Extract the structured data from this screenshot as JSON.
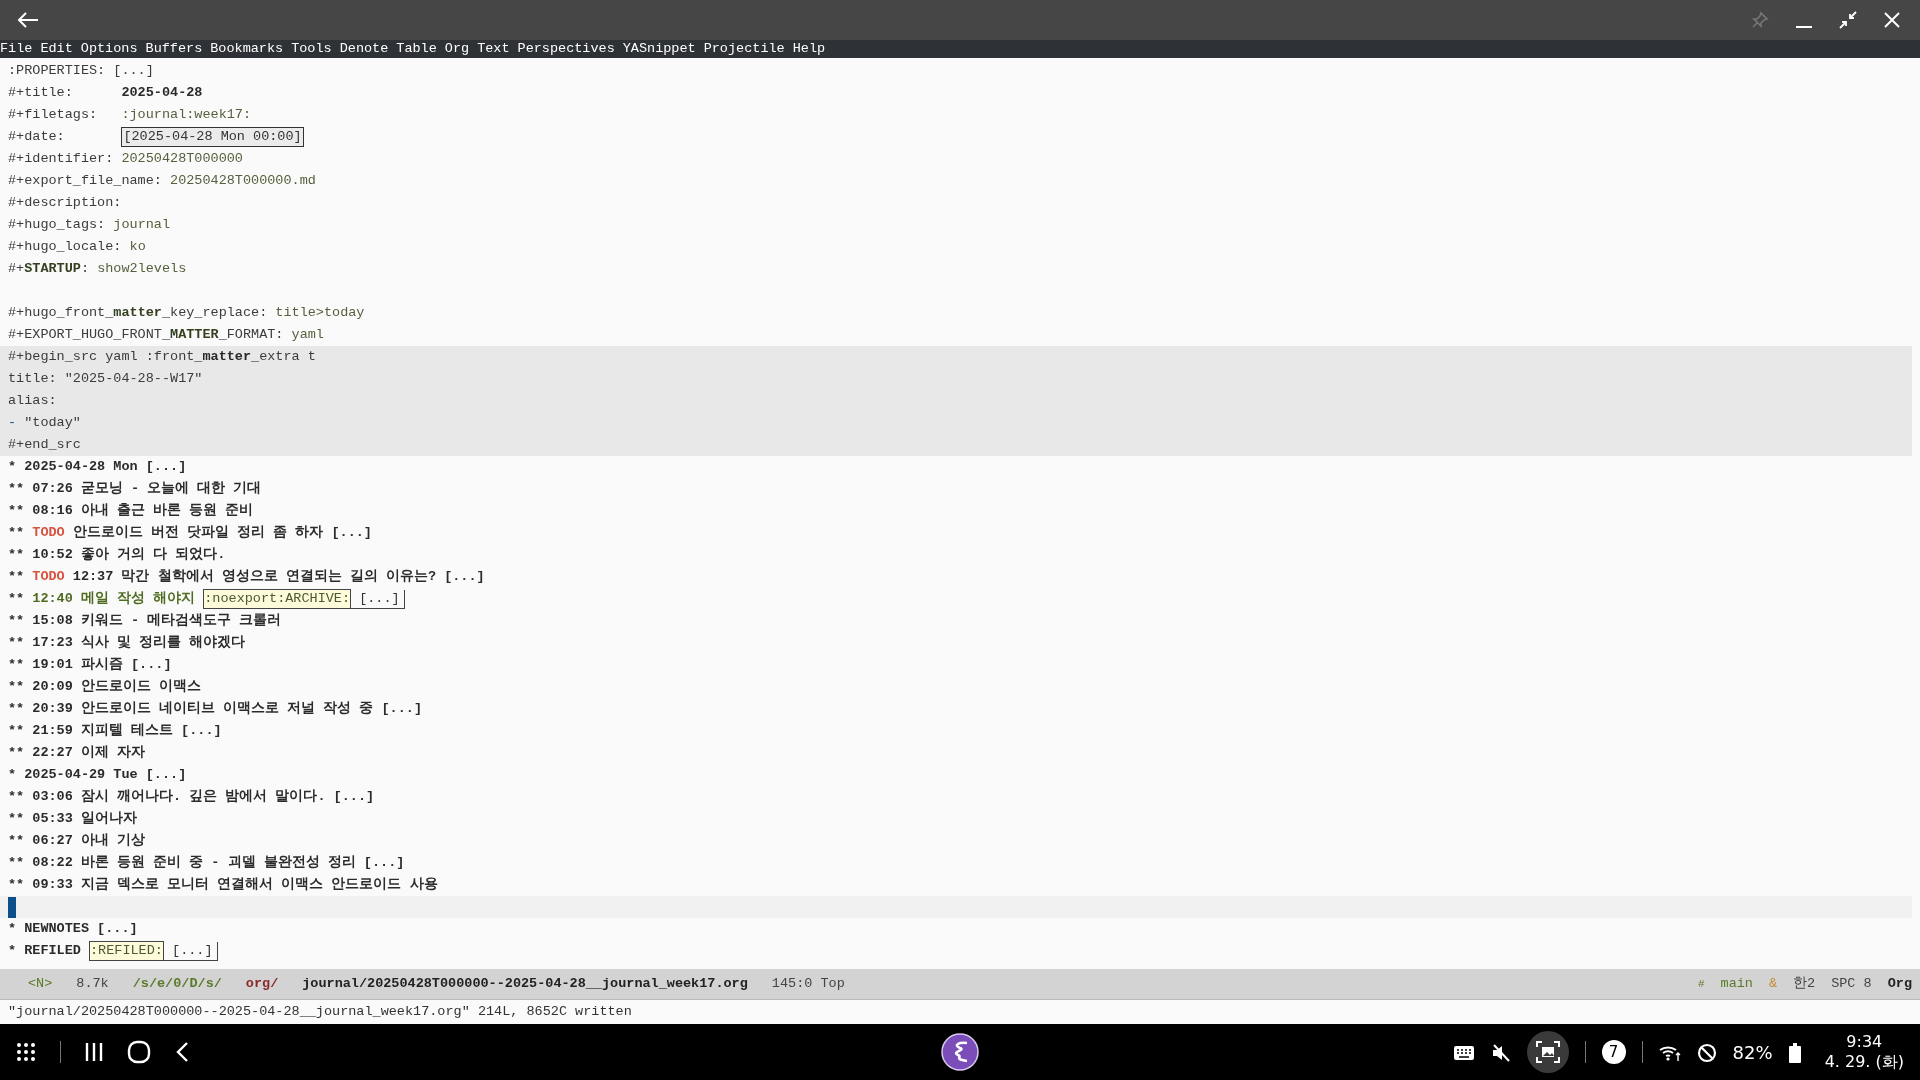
{
  "menu": [
    "File",
    "Edit",
    "Options",
    "Buffers",
    "Bookmarks",
    "Tools",
    "Denote",
    "Table",
    "Org",
    "Text",
    "Perspectives",
    "YASnippet",
    "Projectile",
    "Help"
  ],
  "lines": [
    {
      "kind": "text",
      "segments": [
        {
          "text": ":PROPERTIES: [...]",
          "kind": "meta"
        }
      ]
    },
    {
      "kind": "text",
      "segments": [
        {
          "text": "#+title:      ",
          "kind": "meta"
        },
        {
          "text": "2025-04-28",
          "kind": "strong"
        }
      ]
    },
    {
      "kind": "text",
      "segments": [
        {
          "text": "#+filetags:   ",
          "kind": "meta"
        },
        {
          "text": ":journal:week17:",
          "kind": "value"
        }
      ]
    },
    {
      "kind": "text",
      "segments": [
        {
          "text": "#+date:       ",
          "kind": "meta"
        },
        {
          "text": "[2025-04-28 Mon 00:00]",
          "kind": "date"
        }
      ]
    },
    {
      "kind": "text",
      "segments": [
        {
          "text": "#+identifier: ",
          "kind": "meta"
        },
        {
          "text": "20250428T000000",
          "kind": "value"
        }
      ]
    },
    {
      "kind": "text",
      "segments": [
        {
          "text": "#+export_file_name: ",
          "kind": "meta"
        },
        {
          "text": "20250428T000000.md",
          "kind": "value"
        }
      ]
    },
    {
      "kind": "text",
      "segments": [
        {
          "text": "#+description:",
          "kind": "meta"
        }
      ]
    },
    {
      "kind": "text",
      "segments": [
        {
          "text": "#+hugo_tags: ",
          "kind": "meta"
        },
        {
          "text": "journal",
          "kind": "value"
        }
      ]
    },
    {
      "kind": "text",
      "segments": [
        {
          "text": "#+hugo_locale: ",
          "kind": "meta"
        },
        {
          "text": "ko",
          "kind": "value"
        }
      ]
    },
    {
      "kind": "text",
      "segments": [
        {
          "text": "#+",
          "kind": "meta"
        },
        {
          "text": "STARTUP",
          "kind": "strongvalue"
        },
        {
          "text": ": ",
          "kind": "meta"
        },
        {
          "text": "show2levels",
          "kind": "value"
        }
      ]
    },
    {
      "kind": "blank"
    },
    {
      "kind": "text",
      "segments": [
        {
          "text": "#+hugo_front_",
          "kind": "meta"
        },
        {
          "text": "matter",
          "kind": "strongvalue"
        },
        {
          "text": "_key_replace: ",
          "kind": "meta"
        },
        {
          "text": "title>today",
          "kind": "value"
        }
      ]
    },
    {
      "kind": "text",
      "segments": [
        {
          "text": "#+EXPORT_HUGO_FRONT_",
          "kind": "meta"
        },
        {
          "text": "MATTER",
          "kind": "strongvalue"
        },
        {
          "text": "_FORMAT: ",
          "kind": "meta"
        },
        {
          "text": "yaml",
          "kind": "value"
        }
      ]
    },
    {
      "kind": "src",
      "segments": [
        {
          "text": "#+begin_src yaml :front_",
          "kind": "meta"
        },
        {
          "text": "matter",
          "kind": "strong"
        },
        {
          "text": "_extra t",
          "kind": "meta"
        }
      ]
    },
    {
      "kind": "src",
      "segments": [
        {
          "text": "title: \"2025-04-28--W17\"",
          "kind": "meta"
        }
      ]
    },
    {
      "kind": "src",
      "segments": [
        {
          "text": "alias:",
          "kind": "meta"
        }
      ]
    },
    {
      "kind": "src",
      "segments": [
        {
          "text": "- ",
          "kind": "blue"
        },
        {
          "text": "\"today\"",
          "kind": "meta"
        }
      ]
    },
    {
      "kind": "src",
      "segments": [
        {
          "text": "#+end_src",
          "kind": "meta"
        }
      ]
    },
    {
      "kind": "text",
      "segments": [
        {
          "text": "* 2025-04-28 Mon [...]",
          "kind": "heading"
        }
      ]
    },
    {
      "kind": "text",
      "segments": [
        {
          "text": "** 07:26 굳모닝 - 오늘에 대한 기대",
          "kind": "heading"
        }
      ]
    },
    {
      "kind": "text",
      "segments": [
        {
          "text": "** 08:16 아내 출근 바론 등원 준비",
          "kind": "heading"
        }
      ]
    },
    {
      "kind": "text",
      "segments": [
        {
          "text": "** ",
          "kind": "heading"
        },
        {
          "text": "TODO",
          "kind": "todo"
        },
        {
          "text": " 안드로이드 버전 닷파일 정리 좀 하자 [...]",
          "kind": "heading"
        }
      ]
    },
    {
      "kind": "text",
      "segments": [
        {
          "text": "** 10:52 좋아 거의 다 되었다.",
          "kind": "heading"
        }
      ]
    },
    {
      "kind": "text",
      "segments": [
        {
          "text": "** ",
          "kind": "heading"
        },
        {
          "text": "TODO",
          "kind": "todo"
        },
        {
          "text": " 12:37 막간 철학에서 영성으로 연결되는 길의 이유는? [...]",
          "kind": "heading"
        }
      ]
    },
    {
      "kind": "text",
      "segments": [
        {
          "text": "** ",
          "kind": "heading"
        },
        {
          "text": "12:40 메일 작성 해야지 ",
          "kind": "done"
        },
        {
          "text": ":noexport:ARCHIVE:",
          "kind": "tag"
        },
        {
          "text": " [...]",
          "kind": "fold"
        }
      ]
    },
    {
      "kind": "text",
      "segments": [
        {
          "text": "** 15:08 키워드 - 메타검색도구 크롤러",
          "kind": "heading"
        }
      ]
    },
    {
      "kind": "text",
      "segments": [
        {
          "text": "** 17:23 식사 및 정리를 해야겠다",
          "kind": "heading"
        }
      ]
    },
    {
      "kind": "text",
      "segments": [
        {
          "text": "** 19:01 파시즘 [...]",
          "kind": "heading"
        }
      ]
    },
    {
      "kind": "text",
      "segments": [
        {
          "text": "** 20:09 안드로이드 이맥스",
          "kind": "heading"
        }
      ]
    },
    {
      "kind": "text",
      "segments": [
        {
          "text": "** 20:39 안드로이드 네이티브 이맥스로 저널 작성 중 [...]",
          "kind": "heading"
        }
      ]
    },
    {
      "kind": "text",
      "segments": [
        {
          "text": "** 21:59 지피텔 테스트 [...]",
          "kind": "heading"
        }
      ]
    },
    {
      "kind": "text",
      "segments": [
        {
          "text": "** 22:27 이제 자자",
          "kind": "heading"
        }
      ]
    },
    {
      "kind": "text",
      "segments": [
        {
          "text": "* 2025-04-29 Tue [...]",
          "kind": "heading"
        }
      ]
    },
    {
      "kind": "text",
      "segments": [
        {
          "text": "** 03:06 잠시 깨어나다. 깊은 밤에서 말이다. [...]",
          "kind": "heading"
        }
      ]
    },
    {
      "kind": "text",
      "segments": [
        {
          "text": "** 05:33 일어나자",
          "kind": "heading"
        }
      ]
    },
    {
      "kind": "text",
      "segments": [
        {
          "text": "** 06:27 아내 기상",
          "kind": "heading"
        }
      ]
    },
    {
      "kind": "text",
      "segments": [
        {
          "text": "** 08:22 바론 등원 준비 중 - 괴델 불완전성 정리 [...]",
          "kind": "heading"
        }
      ]
    },
    {
      "kind": "text",
      "segments": [
        {
          "text": "** 09:33 지금 덱스로 모니터 연결해서 이맥스 안드로이드 사용",
          "kind": "heading"
        }
      ]
    },
    {
      "kind": "cursor"
    },
    {
      "kind": "text",
      "segments": [
        {
          "text": "* NEWNOTES [...]",
          "kind": "heading"
        }
      ]
    },
    {
      "kind": "text",
      "segments": [
        {
          "text": "* REFILED ",
          "kind": "heading"
        },
        {
          "text": ":REFILED:",
          "kind": "tag"
        },
        {
          "text": " [...]",
          "kind": "fold"
        }
      ]
    }
  ],
  "mode_line": {
    "left": [
      {
        "text": "<N>",
        "kind": "green"
      },
      {
        "text": "8.7k",
        "kind": "plain"
      },
      {
        "text": "/s/e/0/D/s/",
        "kind": "greenbold"
      },
      {
        "text": "org/",
        "kind": "redbold"
      },
      {
        "text": "journal/20250428T000000--2025-04-28__journal_week17.org",
        "kind": "bold"
      },
      {
        "text": "145:0 Top",
        "kind": "plain"
      }
    ],
    "right": [
      {
        "text": "#",
        "kind": "greensmall"
      },
      {
        "text": "main",
        "kind": "green"
      },
      {
        "text": "&",
        "kind": "orange"
      },
      {
        "text": "한2",
        "kind": "plain"
      },
      {
        "text": "SPC 8",
        "kind": "plain"
      },
      {
        "text": "Org",
        "kind": "bold"
      }
    ]
  },
  "echo_area": "\"journal/20250428T000000--2025-04-28__journal_week17.org\" 214L, 8652C written",
  "taskbar": {
    "notification_count": "7",
    "battery": "82%",
    "time": "9:34",
    "date": "4. 29. (화)"
  }
}
